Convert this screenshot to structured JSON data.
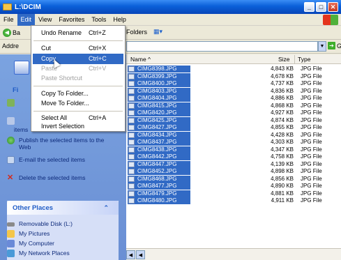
{
  "window": {
    "title": "L:\\DCIM"
  },
  "menubar": {
    "items": [
      "File",
      "Edit",
      "View",
      "Favorites",
      "Tools",
      "Help"
    ]
  },
  "toolbar": {
    "back_label": "Ba",
    "folders_label": "Folders"
  },
  "addressbar": {
    "label": "Addre",
    "value": "",
    "go_label": "Go"
  },
  "edit_menu": {
    "items": [
      {
        "label": "Undo Rename",
        "shortcut": "Ctrl+Z",
        "state": "normal"
      },
      {
        "label": "Cut",
        "shortcut": "Ctrl+X",
        "state": "normal"
      },
      {
        "label": "Copy",
        "shortcut": "Ctrl+C",
        "state": "highlight"
      },
      {
        "label": "Paste",
        "shortcut": "Ctrl+V",
        "state": "disabled"
      },
      {
        "label": "Paste Shortcut",
        "shortcut": "",
        "state": "disabled"
      },
      {
        "label": "Copy To Folder...",
        "shortcut": "",
        "state": "normal"
      },
      {
        "label": "Move To Folder...",
        "shortcut": "",
        "state": "normal"
      },
      {
        "label": "Select All",
        "shortcut": "Ctrl+A",
        "state": "normal"
      },
      {
        "label": "Invert Selection",
        "shortcut": "",
        "state": "normal"
      }
    ]
  },
  "leftpane": {
    "tasks_heading_fragment": "Fi",
    "tasks": [
      {
        "label": "Publish the selected items to the Web",
        "icon": "globe-icon"
      },
      {
        "label": "E-mail the selected items",
        "icon": "email-icon"
      },
      {
        "label": "Delete the selected items",
        "icon": "delete-x-icon"
      }
    ],
    "tasks_partial": "items",
    "other_places": {
      "heading": "Other Places",
      "items": [
        {
          "label": "Removable Disk (L:)",
          "icon": "removable-disk-icon"
        },
        {
          "label": "My Pictures",
          "icon": "my-pictures-icon"
        },
        {
          "label": "My Computer",
          "icon": "my-computer-icon"
        },
        {
          "label": "My Network Places",
          "icon": "network-places-icon"
        }
      ]
    }
  },
  "filelist": {
    "columns": {
      "name": "Name",
      "size": "Size",
      "type": "Type"
    },
    "files": [
      {
        "name": "CIMG8398.JPG",
        "size": "4,843 KB",
        "type": "JPG File"
      },
      {
        "name": "CIMG8399.JPG",
        "size": "4,678 KB",
        "type": "JPG File"
      },
      {
        "name": "CIMG8400.JPG",
        "size": "4,737 KB",
        "type": "JPG File"
      },
      {
        "name": "CIMG8403.JPG",
        "size": "4,836 KB",
        "type": "JPG File"
      },
      {
        "name": "CIMG8404.JPG",
        "size": "4,886 KB",
        "type": "JPG File"
      },
      {
        "name": "CIMG8415.JPG",
        "size": "4,868 KB",
        "type": "JPG File"
      },
      {
        "name": "CIMG8420.JPG",
        "size": "4,927 KB",
        "type": "JPG File"
      },
      {
        "name": "CIMG8425.JPG",
        "size": "4,874 KB",
        "type": "JPG File"
      },
      {
        "name": "CIMG8427.JPG",
        "size": "4,855 KB",
        "type": "JPG File"
      },
      {
        "name": "CIMG8434.JPG",
        "size": "4,428 KB",
        "type": "JPG File"
      },
      {
        "name": "CIMG8437.JPG",
        "size": "4,303 KB",
        "type": "JPG File"
      },
      {
        "name": "CIMG8438.JPG",
        "size": "4,347 KB",
        "type": "JPG File"
      },
      {
        "name": "CIMG8442.JPG",
        "size": "4,758 KB",
        "type": "JPG File"
      },
      {
        "name": "CIMG8447.JPG",
        "size": "4,139 KB",
        "type": "JPG File"
      },
      {
        "name": "CIMG8452.JPG",
        "size": "4,898 KB",
        "type": "JPG File"
      },
      {
        "name": "CIMG8468.JPG",
        "size": "4,856 KB",
        "type": "JPG File"
      },
      {
        "name": "CIMG8477.JPG",
        "size": "4,890 KB",
        "type": "JPG File"
      },
      {
        "name": "CIMG8479.JPG",
        "size": "4,881 KB",
        "type": "JPG File"
      },
      {
        "name": "CIMG8480.JPG",
        "size": "4,911 KB",
        "type": "JPG File"
      }
    ]
  },
  "colors": {
    "titlebar": "#0a5fd8",
    "selection": "#316ac5",
    "taskpane": "#7ba3e0",
    "link_text": "#0d2a7a"
  }
}
